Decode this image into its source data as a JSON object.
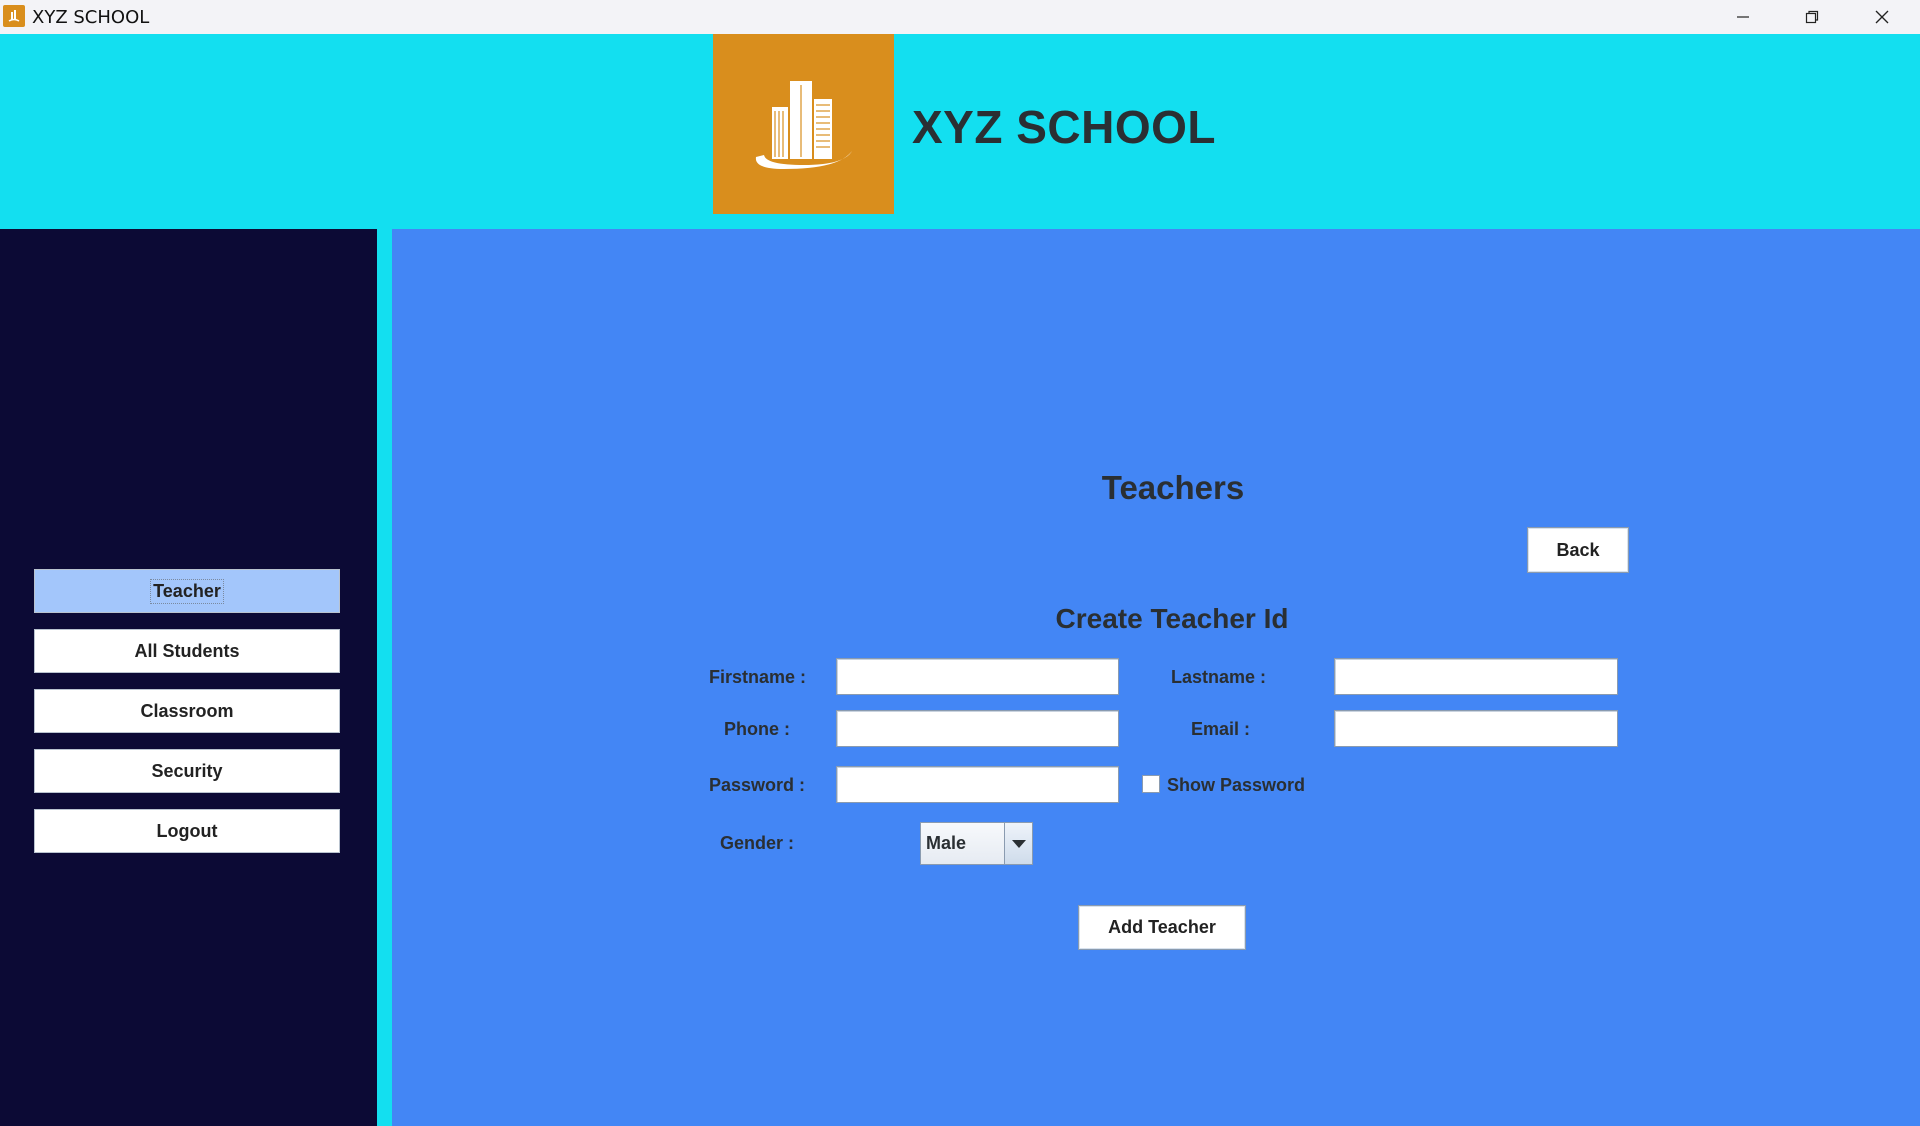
{
  "window": {
    "title": "XYZ SCHOOL",
    "icons": [
      "app-icon",
      "minimize-icon",
      "restore-icon",
      "close-icon"
    ]
  },
  "header": {
    "school_name": "XYZ SCHOOL",
    "logo_icon": "city-buildings-logo"
  },
  "sidebar": {
    "items": [
      {
        "label": "Teacher",
        "active": true
      },
      {
        "label": "All Students",
        "active": false
      },
      {
        "label": "Classroom",
        "active": false
      },
      {
        "label": "Security",
        "active": false
      },
      {
        "label": "Logout",
        "active": false
      }
    ]
  },
  "main": {
    "title": "Teachers",
    "back_label": "Back",
    "form_title": "Create Teacher Id",
    "fields": {
      "firstname_label": "Firstname :",
      "firstname_value": "",
      "lastname_label": "Lastname :",
      "lastname_value": "",
      "phone_label": "Phone :",
      "phone_value": "",
      "email_label": "Email :",
      "email_value": "",
      "password_label": "Password :",
      "password_value": "",
      "show_password_label": "Show Password",
      "show_password_checked": false,
      "gender_label": "Gender :",
      "gender_value": "Male"
    },
    "add_label": "Add Teacher"
  },
  "colors": {
    "header_bg": "#13dff0",
    "logo_bg": "#d98e1d",
    "sidebar_bg": "#0c0a35",
    "main_bg": "#4386f5",
    "active_item_bg": "#a3c6fb"
  }
}
